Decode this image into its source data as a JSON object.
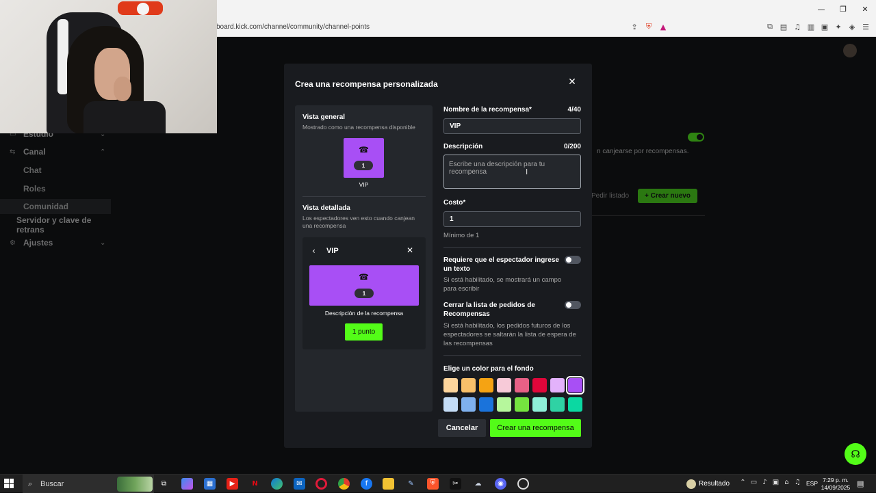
{
  "browser": {
    "url": "board.kick.com/channel/community/channel-points",
    "window_controls": [
      "—",
      "❐",
      "✕"
    ]
  },
  "sidebar": {
    "items": [
      {
        "label": "Estudio",
        "icon": "studio-icon",
        "chevron": "⌄"
      },
      {
        "label": "Canal",
        "icon": "channel-icon",
        "chevron": "⌃"
      },
      {
        "label": "Chat"
      },
      {
        "label": "Roles"
      },
      {
        "label": "Comunidad"
      },
      {
        "label": "Servidor y clave de retrans"
      },
      {
        "label": "Ajustes",
        "icon": "gear-icon",
        "chevron": "⌄"
      }
    ]
  },
  "background": {
    "desc_text": "n canjearse por recompensas.",
    "ghost_button": "Pedir listado",
    "create_button": "+ Crear nuevo"
  },
  "modal": {
    "title": "Crea una recompensa personalizada",
    "close_icon": "✕",
    "preview": {
      "general_heading": "Vista general",
      "general_sub": "Mostrado como una recompensa disponible",
      "tile_icon": "☎",
      "cost_value": "1",
      "reward_name": "VIP",
      "detailed_heading": "Vista detallada",
      "detailed_sub": "Los espectadores ven esto cuando canjean una recompensa",
      "back_icon": "‹",
      "card_close_icon": "✕",
      "description_placeholder": "Descripción de la recompensa",
      "cost_button": "1 punto"
    },
    "form": {
      "name_label": "Nombre de la recompensa*",
      "name_counter": "4/40",
      "name_value": "VIP",
      "description_label": "Descripción",
      "description_counter": "0/200",
      "description_placeholder": "Escribe una descripción para tu recompensa",
      "cost_label": "Costo*",
      "cost_value": "1",
      "cost_hint": "Mínimo de 1",
      "require_text_label": "Requiere que el espectador ingrese un texto",
      "require_text_hint": "Si está habilitado, se mostrará un campo para escribir",
      "require_text_enabled": false,
      "skip_queue_label": "Cerrar la lista de pedidos de Recompensas",
      "skip_queue_hint": "Si está habilitado, los pedidos futuros de los espectadores se saltarán la lista de espera de las recompensas",
      "skip_queue_enabled": false,
      "color_label": "Elige un color para el fondo",
      "colors": [
        "#fdd59c",
        "#f8c06a",
        "#f5a313",
        "#f7cad8",
        "#e86086",
        "#e0063a",
        "#e3b2fb",
        "#a84ff5",
        "#c4dcf6",
        "#7fb1ee",
        "#1a73db",
        "#b6f79c",
        "#75e33f",
        "#8ef0d9",
        "#2fd2a4",
        "#0bd8a2"
      ],
      "selected_color": "#a84ff5"
    },
    "cancel_label": "Cancelar",
    "create_label": "Crear una recompensa"
  },
  "taskbar": {
    "search_label": "Buscar",
    "result_label": "Resultado",
    "lang": "ESP",
    "time": "7:29 p. m.",
    "date": "14/09/2025",
    "apps": [
      "task-view",
      "copilot",
      "store",
      "youtube",
      "netflix",
      "edge",
      "outlook",
      "opera",
      "chrome",
      "facebook",
      "explorer",
      "app-blue",
      "brave",
      "capcut",
      "app-cloud",
      "discord",
      "obs"
    ]
  },
  "accent": "#53fc18"
}
